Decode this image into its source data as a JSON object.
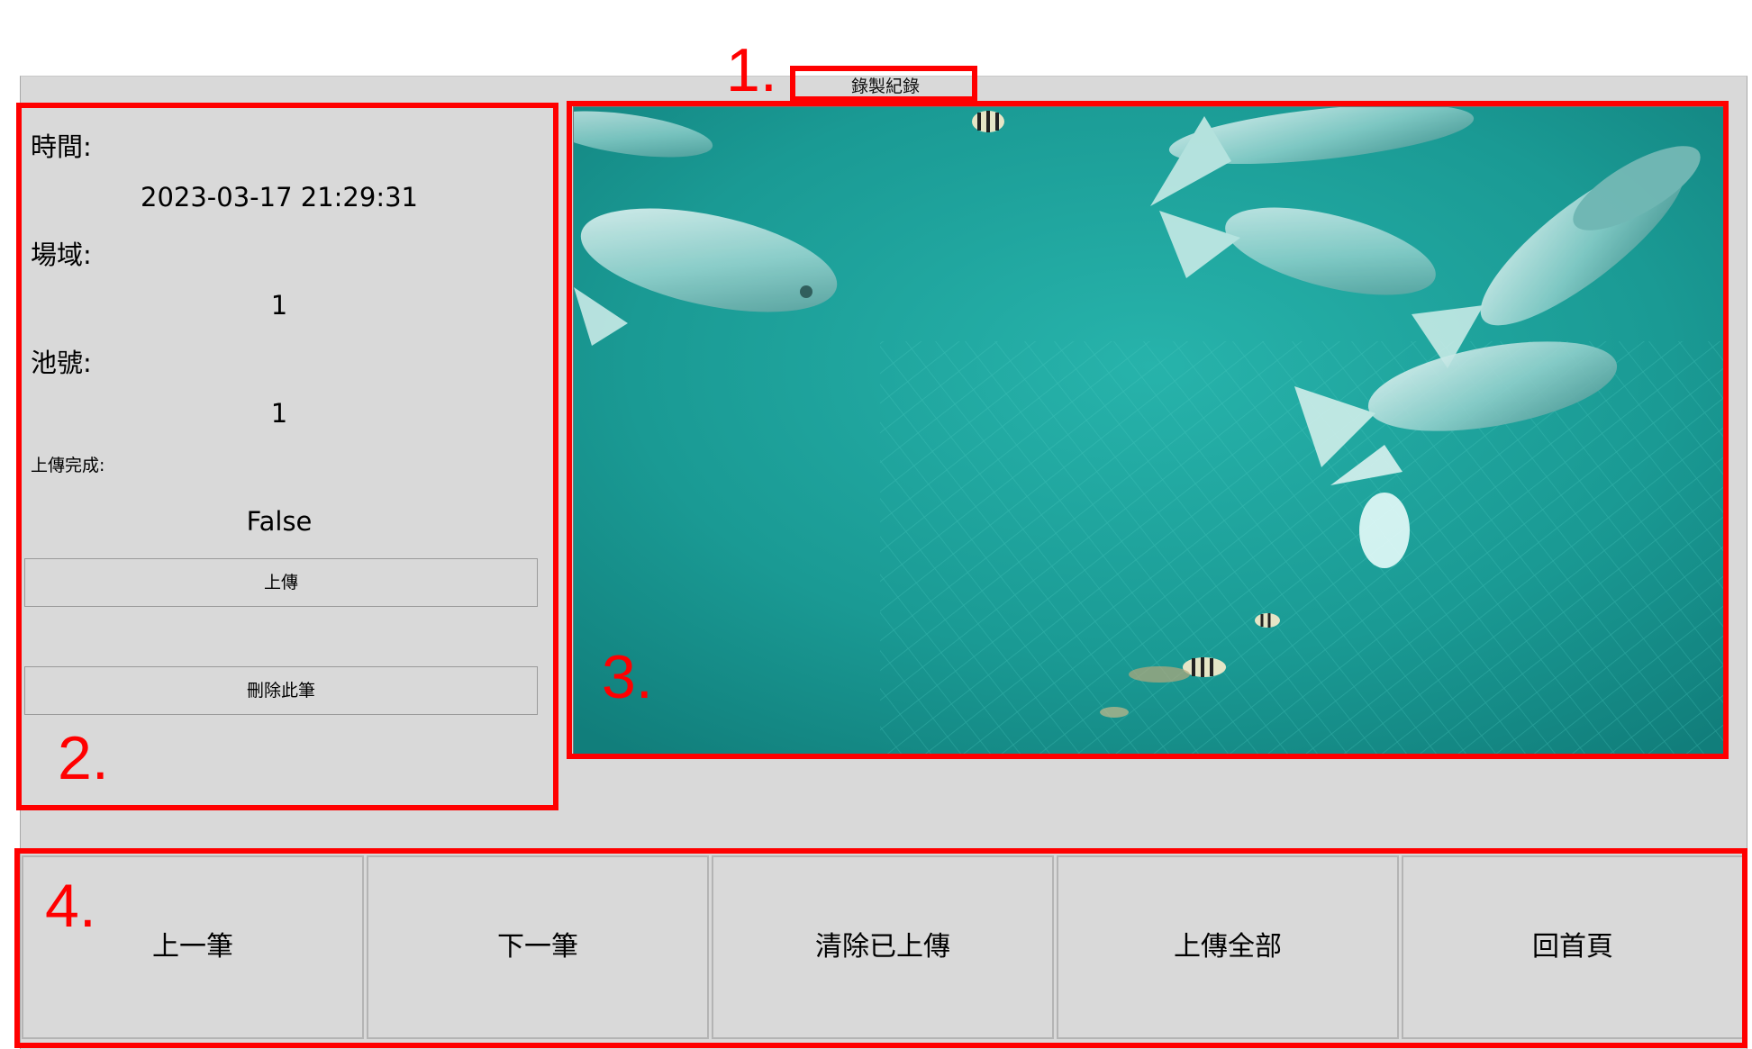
{
  "window": {
    "title": "錄製紀錄"
  },
  "callouts": [
    "1.",
    "2.",
    "3.",
    "4."
  ],
  "details": {
    "time_label": "時間:",
    "time_value": "2023-03-17 21:29:31",
    "site_label": "場域:",
    "site_value": "1",
    "pool_label": "池號:",
    "pool_value": "1",
    "upload_done_label": "上傳完成:",
    "upload_done_value": "False",
    "upload_button": "上傳",
    "delete_button": "刪除此筆"
  },
  "video": {
    "description_icon": "underwater-fish-frame"
  },
  "nav": {
    "buttons": [
      "上一筆",
      "下一筆",
      "清除已上傳",
      "上傳全部",
      "回首頁"
    ]
  },
  "colors": {
    "highlight": "#ff0000",
    "window_bg": "#d9d9d9",
    "water": "#1a9a94"
  }
}
